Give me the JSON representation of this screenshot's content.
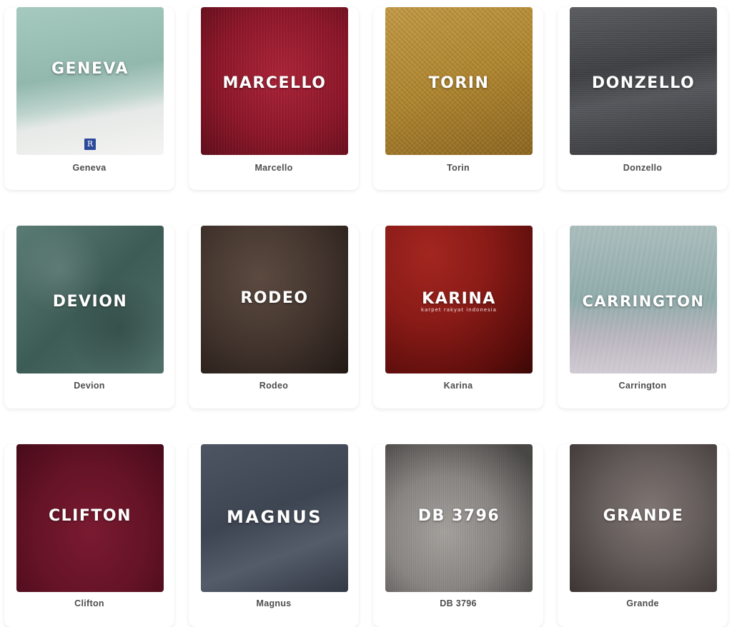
{
  "products": [
    {
      "caption": "Geneva",
      "overlay": "GENEVA",
      "badge": "R",
      "color": "#9bbfb5",
      "accent": "#e9efec",
      "icon": "fabric-swatch-image"
    },
    {
      "caption": "Marcello",
      "overlay": "MARCELLO",
      "color": "#8e1a2b",
      "accent": "#6b0f1e",
      "icon": "fabric-swatch-image"
    },
    {
      "caption": "Torin",
      "overlay": "TORIN",
      "color": "#b78a33",
      "accent": "#8f6a22",
      "icon": "fabric-swatch-image"
    },
    {
      "caption": "Donzello",
      "overlay": "DONZELLO",
      "color": "#3b3b3d",
      "accent": "#595a5c",
      "icon": "fabric-swatch-image"
    },
    {
      "caption": "Devion",
      "overlay": "DEVION",
      "color": "#40605a",
      "accent": "#6f8d86",
      "icon": "fabric-swatch-image"
    },
    {
      "caption": "Rodeo",
      "overlay": "RODEO",
      "color": "#4a3a32",
      "accent": "#2b211c",
      "icon": "fabric-swatch-image"
    },
    {
      "caption": "Karina",
      "overlay": "KARINA",
      "subtitle": "karpet rakyat indonesia",
      "color": "#8c1c18",
      "accent": "#5a0c0a",
      "icon": "fabric-swatch-image"
    },
    {
      "caption": "Carrington",
      "overlay": "CARRINGTON",
      "color": "#9ab2b1",
      "accent": "#c9c4cc",
      "icon": "fabric-swatch-image"
    },
    {
      "caption": "Clifton",
      "overlay": "CLIFTON",
      "color": "#6a1429",
      "accent": "#4a0c1c",
      "icon": "fabric-swatch-image"
    },
    {
      "caption": "Magnus",
      "overlay": "MAGNUS",
      "color": "#3e4552",
      "accent": "#5a6270",
      "icon": "fabric-swatch-image"
    },
    {
      "caption": "DB 3796",
      "overlay": "DB 3796",
      "color": "#8c8a87",
      "accent": "#4d4b49",
      "icon": "fabric-swatch-image"
    },
    {
      "caption": "Grande",
      "overlay": "GRANDE",
      "color": "#6a6260",
      "accent": "#3f3837",
      "icon": "fabric-swatch-image"
    }
  ]
}
